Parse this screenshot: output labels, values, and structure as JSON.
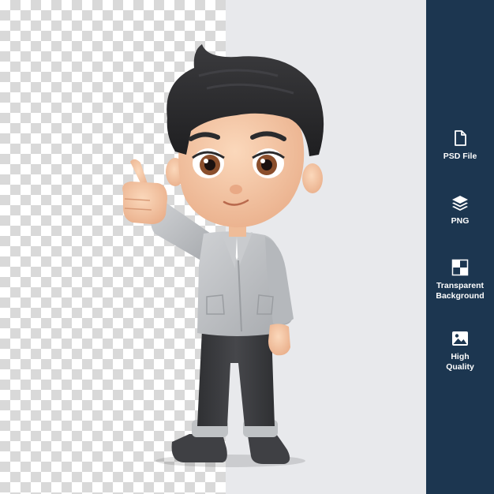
{
  "colors": {
    "sidebar_bg": "#1c3650",
    "plain_bg": "#e8e9ec",
    "checker_dark": "#d9d9d9",
    "jacket": "#b9bcc0",
    "pants": "#3a3b3e",
    "hair": "#2e2e30",
    "skin": "#f6c9a6"
  },
  "sidebar": {
    "features": [
      {
        "icon": "file-icon",
        "label": "PSD File"
      },
      {
        "icon": "layers-icon",
        "label": "PNG"
      },
      {
        "icon": "transparency-grid-icon",
        "label": "Transparent\nBackground"
      },
      {
        "icon": "image-icon",
        "label": "High\nQuality"
      }
    ]
  }
}
